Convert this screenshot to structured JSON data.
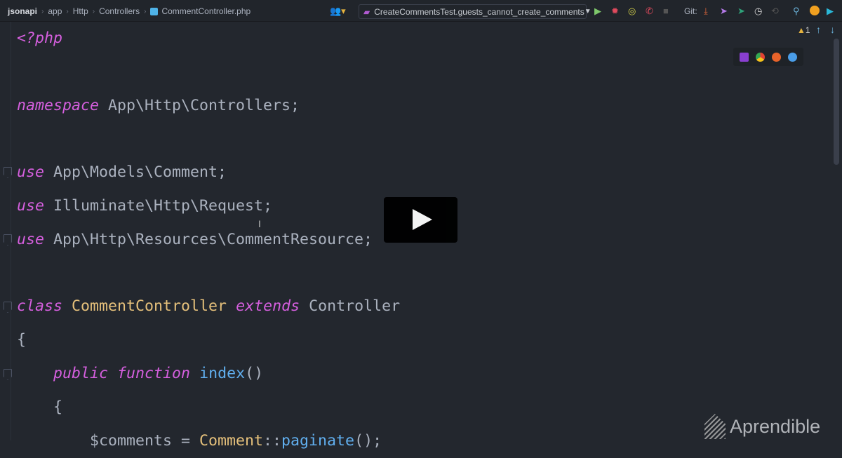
{
  "breadcrumb": [
    "jsonapi",
    "app",
    "Http",
    "Controllers",
    "CommentController.php"
  ],
  "run_config": "CreateCommentsTest.guests_cannot_create_comments",
  "git_label": "Git:",
  "warnings": "1",
  "logo": "Aprendible",
  "code_lines": [
    [
      [
        "<?php",
        "kw"
      ]
    ],
    [],
    [
      [
        "namespace",
        "kw"
      ],
      [
        " App\\Http\\Controllers;",
        ""
      ]
    ],
    [],
    [
      [
        "use",
        "kw"
      ],
      [
        " App\\Models\\Comment;",
        ""
      ]
    ],
    [
      [
        "use",
        "kw"
      ],
      [
        " Illuminate\\Http\\Request;",
        ""
      ]
    ],
    [
      [
        "use",
        "kw"
      ],
      [
        " App\\Http\\Resources\\CommentResource;",
        ""
      ]
    ],
    [],
    [
      [
        "class",
        "kw"
      ],
      [
        " ",
        ""
      ],
      [
        "CommentController",
        "cls"
      ],
      [
        " ",
        ""
      ],
      [
        "extends",
        "kw"
      ],
      [
        " Controller",
        ""
      ]
    ],
    [
      [
        "{",
        ""
      ]
    ],
    [
      [
        "    ",
        ""
      ],
      [
        "public",
        "kw"
      ],
      [
        " ",
        ""
      ],
      [
        "function",
        "kw"
      ],
      [
        " ",
        ""
      ],
      [
        "index",
        "fn"
      ],
      [
        "()",
        ""
      ]
    ],
    [
      [
        "    {",
        ""
      ]
    ],
    [
      [
        "        $comments = ",
        ""
      ],
      [
        "Comment",
        "cls"
      ],
      [
        "::",
        ""
      ],
      [
        "paginate",
        "fn"
      ],
      [
        "();",
        ""
      ]
    ]
  ]
}
